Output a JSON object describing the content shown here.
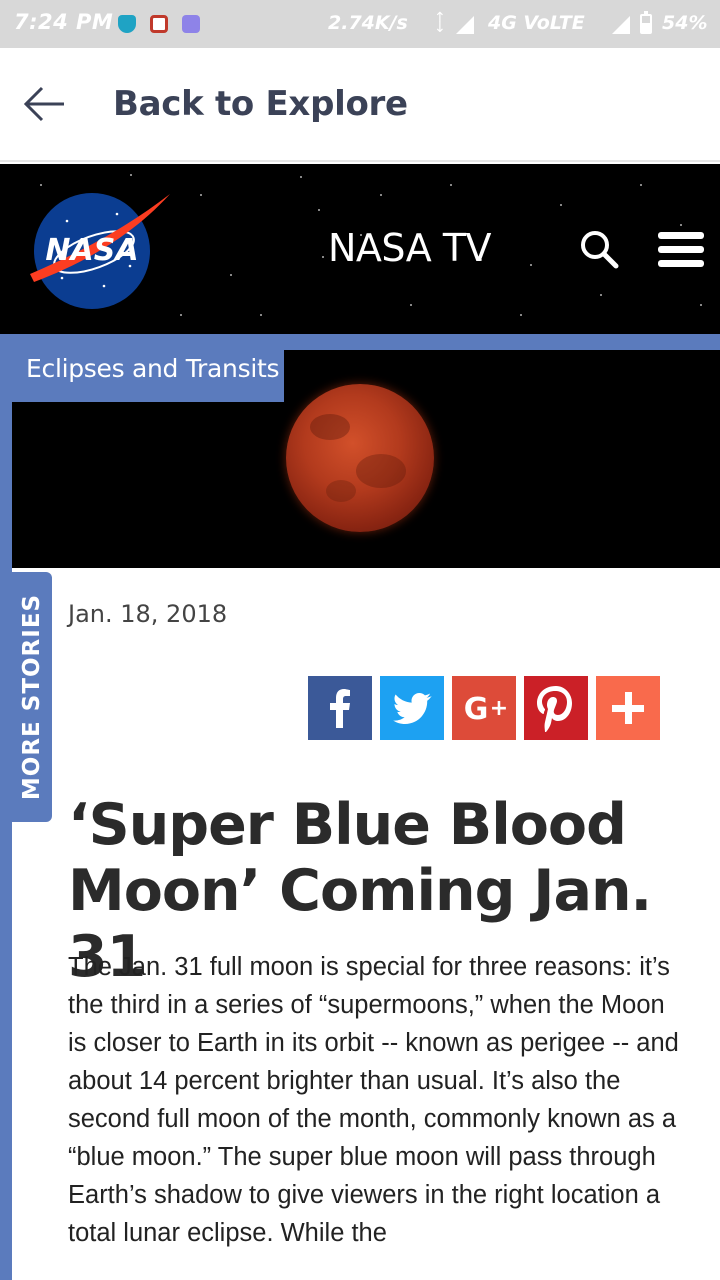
{
  "status_bar": {
    "time": "7:24 PM",
    "speed": "2.74K/s",
    "network": "4G VoLTE",
    "battery_percent": "54%",
    "battery_level": 0.54
  },
  "nav": {
    "back_label": "Back to Explore"
  },
  "header": {
    "logo_text": "NASA",
    "tv_label": "NASA TV"
  },
  "hero": {
    "category": "Eclipses and Transits"
  },
  "side_tab": {
    "label": "MORE STORIES"
  },
  "article": {
    "date": "Jan. 18, 2018",
    "title": "‘Super Blue Blood Moon’ Coming Jan. 31",
    "body": "The Jan. 31 full moon is special for three reasons: it’s the third in a series of “supermoons,” when the Moon is closer to Earth in its orbit -- known as perigee -- and about 14 percent brighter than usual. It’s also the second full moon of the month, commonly known as a “blue moon.” The super blue moon will pass through Earth’s shadow to give viewers in the right location a total lunar eclipse. While the"
  },
  "share": {
    "buttons": [
      {
        "name": "facebook",
        "label": "f",
        "color": "#3b5998"
      },
      {
        "name": "twitter",
        "label": "twitter",
        "color": "#1da1f2"
      },
      {
        "name": "google-plus",
        "label": "G+",
        "color": "#dd4b39"
      },
      {
        "name": "pinterest",
        "label": "P",
        "color": "#cb2027"
      },
      {
        "name": "more",
        "label": "+",
        "color": "#f96a4c"
      }
    ]
  },
  "colors": {
    "accent": "#5b7bbd",
    "header_bg": "#000000",
    "status_bg": "#d8d8d8"
  }
}
